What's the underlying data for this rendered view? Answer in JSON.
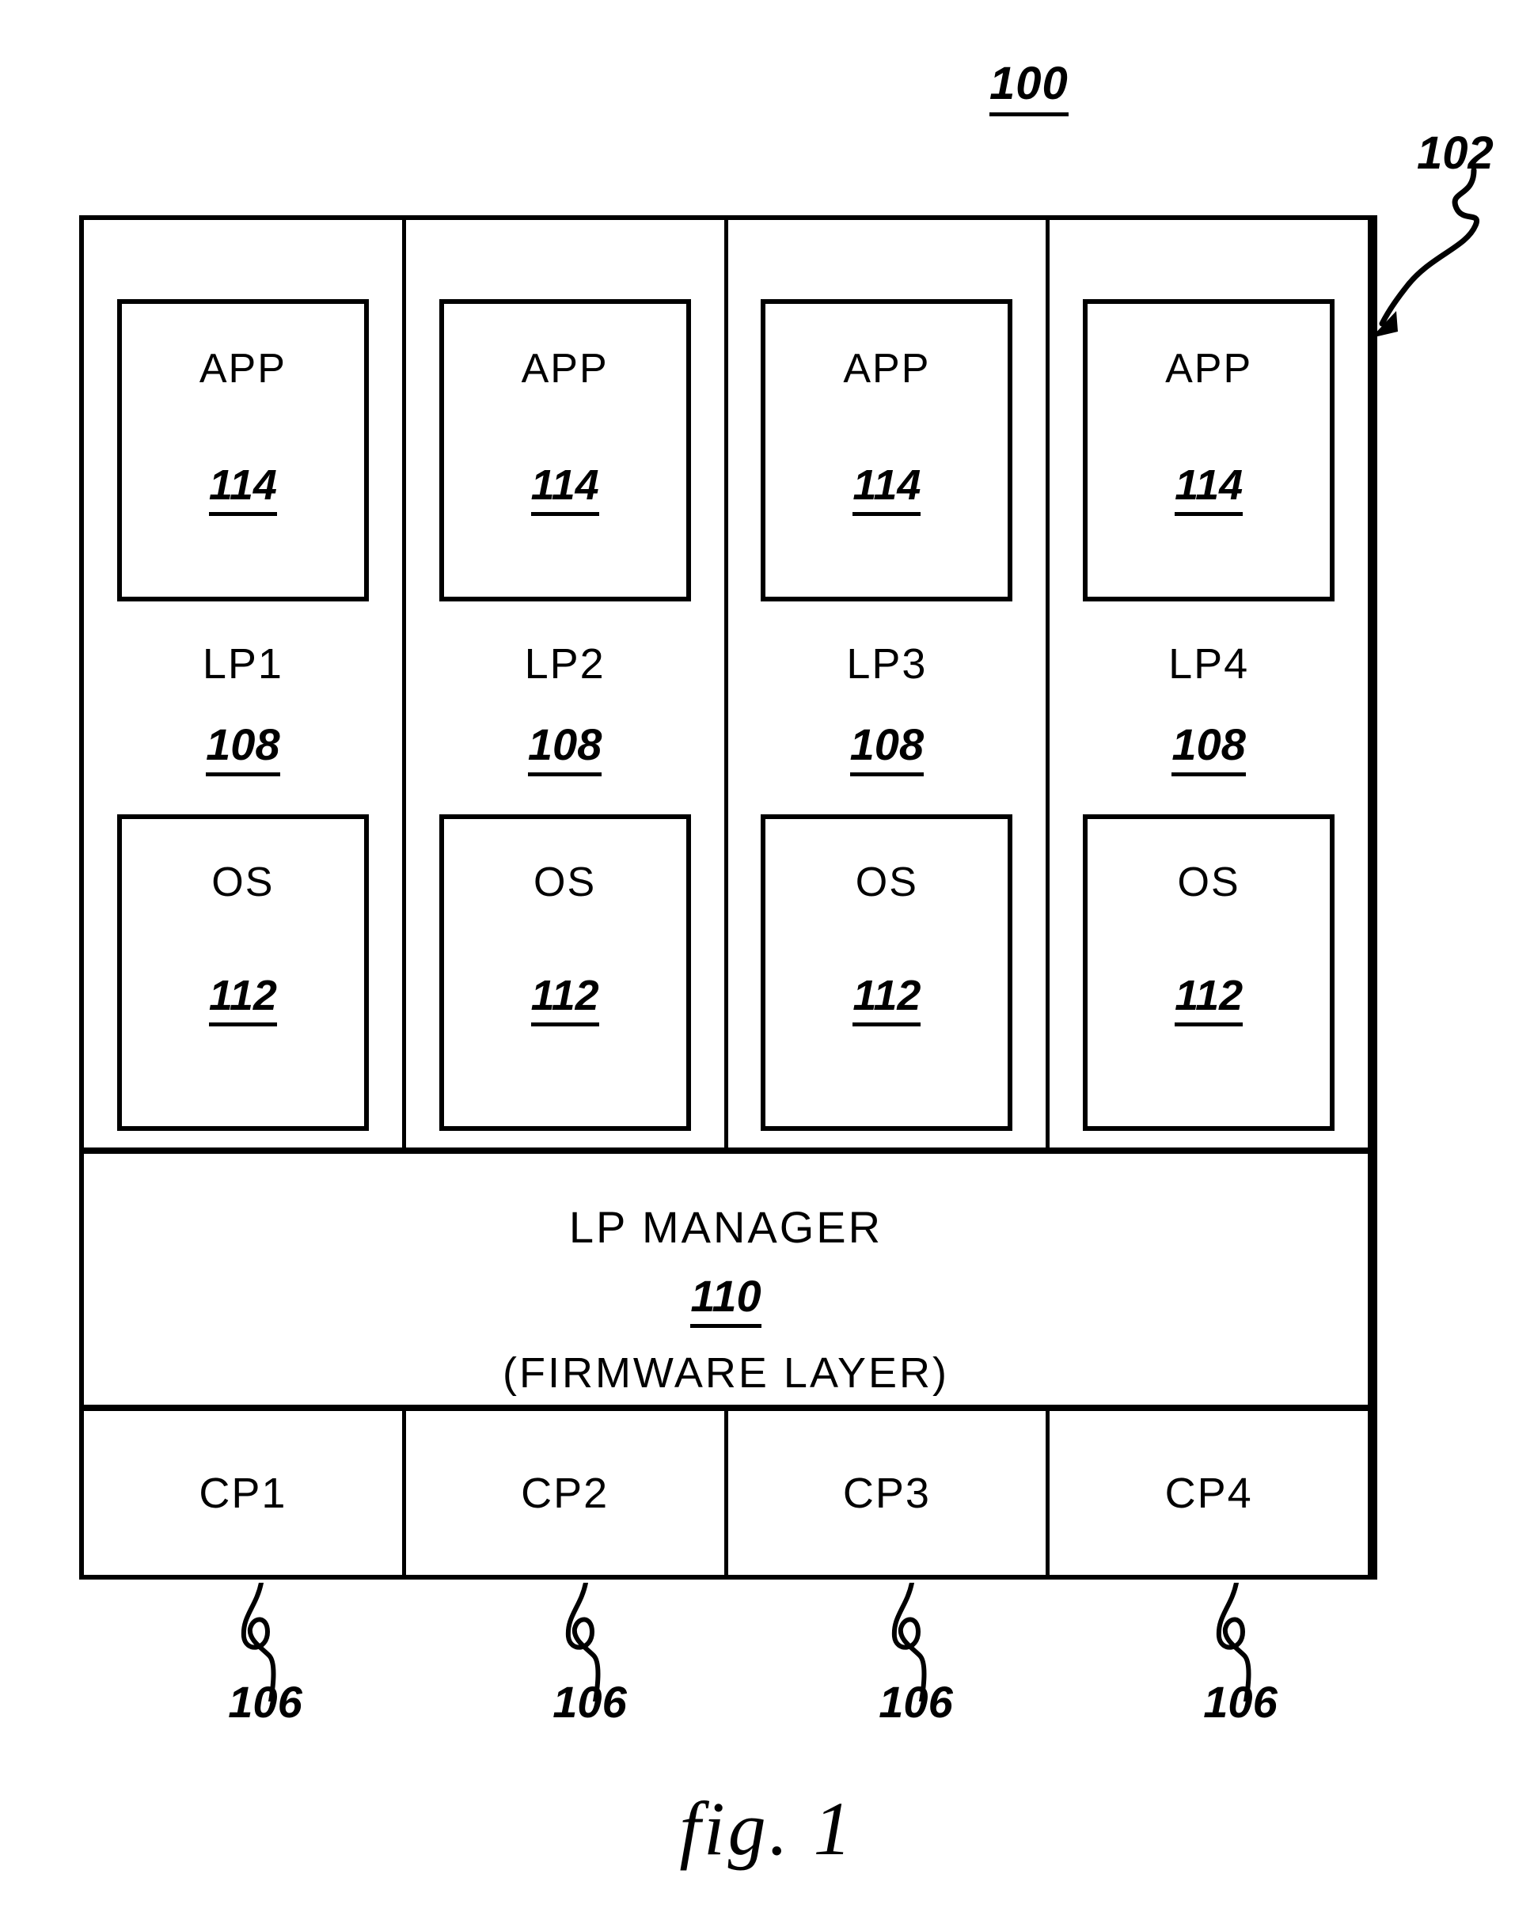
{
  "figure": {
    "system_ref": "100",
    "system_box_ref": "102",
    "caption": "fig. 1"
  },
  "partitions": [
    {
      "app_label": "APP",
      "app_ref": "114",
      "lp_label": "LP1",
      "lp_ref": "108",
      "os_label": "OS",
      "os_ref": "112"
    },
    {
      "app_label": "APP",
      "app_ref": "114",
      "lp_label": "LP2",
      "lp_ref": "108",
      "os_label": "OS",
      "os_ref": "112"
    },
    {
      "app_label": "APP",
      "app_ref": "114",
      "lp_label": "LP3",
      "lp_ref": "108",
      "os_label": "OS",
      "os_ref": "112"
    },
    {
      "app_label": "APP",
      "app_ref": "114",
      "lp_label": "LP4",
      "lp_ref": "108",
      "os_label": "OS",
      "os_ref": "112"
    }
  ],
  "lp_manager": {
    "title": "LP MANAGER",
    "ref": "110",
    "subtitle": "(FIRMWARE LAYER)"
  },
  "processors": [
    {
      "label": "CP1",
      "break_ref": "106"
    },
    {
      "label": "CP2",
      "break_ref": "106"
    },
    {
      "label": "CP3",
      "break_ref": "106"
    },
    {
      "label": "CP4",
      "break_ref": "106"
    }
  ]
}
